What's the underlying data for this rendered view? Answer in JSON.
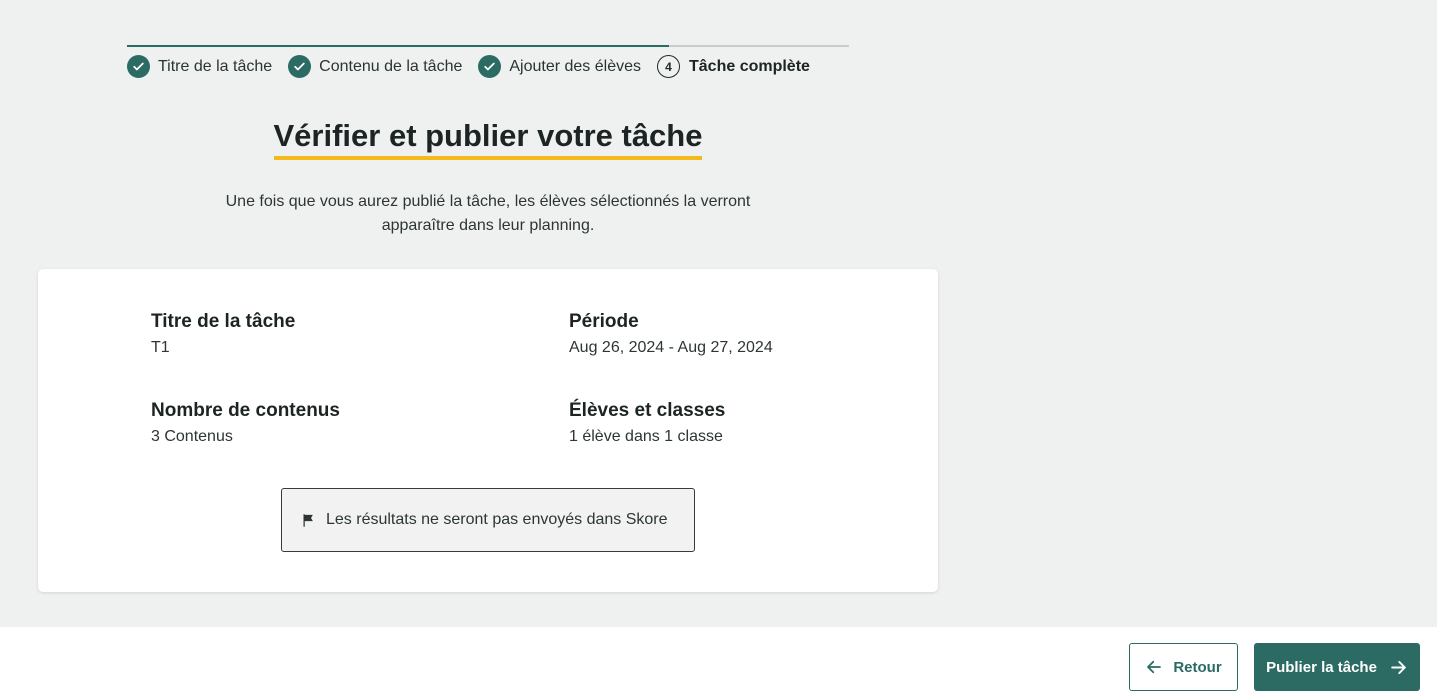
{
  "stepper": {
    "steps": [
      {
        "label": "Titre de la tâche",
        "state": "done"
      },
      {
        "label": "Contenu de la tâche",
        "state": "done"
      },
      {
        "label": "Ajouter des élèves",
        "state": "done"
      },
      {
        "label": "Tâche complète",
        "state": "current",
        "number": "4"
      }
    ],
    "progress_percent": 75
  },
  "header": {
    "title": "Vérifier et publier votre tâche",
    "subtitle": "Une fois que vous aurez publié la tâche, les élèves sélectionnés la verront apparaître dans leur planning."
  },
  "summary": {
    "task_title_label": "Titre de la tâche",
    "task_title_value": "T1",
    "period_label": "Période",
    "period_value": "Aug 26, 2024 - Aug 27, 2024",
    "content_count_label": "Nombre de contenus",
    "content_count_value": "3 Contenus",
    "students_label": "Élèves et classes",
    "students_value": "1 élève dans 1 classe",
    "notice": "Les résultats ne seront pas envoyés dans Skore"
  },
  "footer": {
    "back_label": "Retour",
    "publish_label": "Publier la tâche"
  },
  "colors": {
    "primary": "#2b6b63",
    "accent_underline": "#f4b91a",
    "background": "#eff1f0"
  },
  "icons": {
    "step_done": "check-circle-icon",
    "notice": "flag-icon",
    "back": "arrow-left-icon",
    "publish": "arrow-right-icon"
  }
}
